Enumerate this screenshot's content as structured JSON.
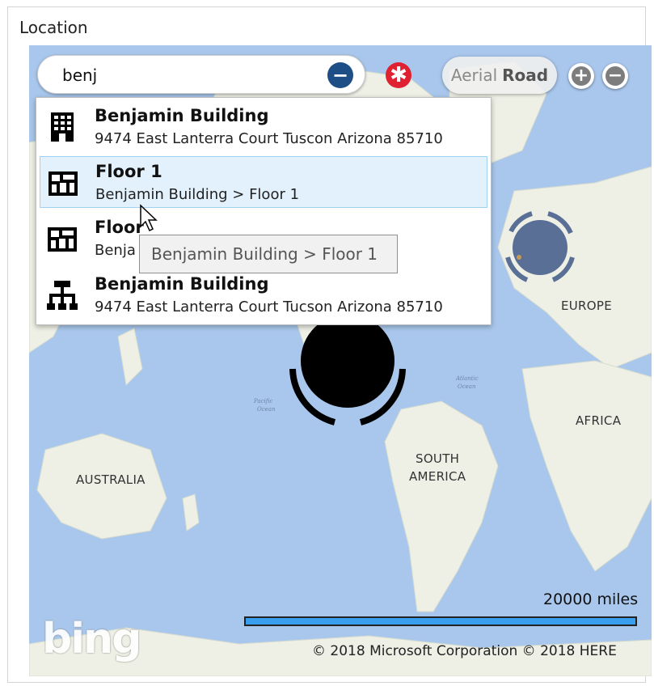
{
  "section": {
    "label": "Location"
  },
  "search": {
    "value": "benj"
  },
  "map_type": {
    "aerial_label": "Aerial",
    "road_label": "Road",
    "selected": "Road"
  },
  "zoom": {
    "in_label": "+",
    "out_label": "−"
  },
  "results": [
    {
      "icon": "building-icon",
      "title": "Benjamin Building",
      "subtitle": "9474 East Lanterra Court  Tuscon Arizona 85710"
    },
    {
      "icon": "floor-plan-icon",
      "title": "Floor 1",
      "subtitle": "Benjamin Building > Floor 1",
      "selected": true
    },
    {
      "icon": "floor-plan-icon",
      "title": "Floor",
      "subtitle": "Benja"
    },
    {
      "icon": "org-chart-icon",
      "title": "Benjamin Building",
      "subtitle": "9474 East Lanterra Court  Tucson Arizona 85710"
    }
  ],
  "tooltip": {
    "text": "Benjamin Building > Floor 1"
  },
  "map": {
    "labels": {
      "europe": "EUROPE",
      "africa": "AFRICA",
      "south_america_1": "SOUTH",
      "south_america_2": "AMERICA",
      "australia": "AUSTRALIA",
      "pacific_1": "Pacific",
      "pacific_2": "Ocean",
      "atlantic_1": "Atlantic",
      "atlantic_2": "Ocean"
    },
    "scale_label": "20000 miles",
    "logo": "bing",
    "copyright": "© 2018 Microsoft Corporation   © 2018 HERE"
  },
  "colors": {
    "water": "#a9c7ec",
    "land": "#eef0e6",
    "accent_blue": "#1d4f86",
    "clear_red": "#e02132",
    "selection_bg": "#e2f1fb"
  }
}
